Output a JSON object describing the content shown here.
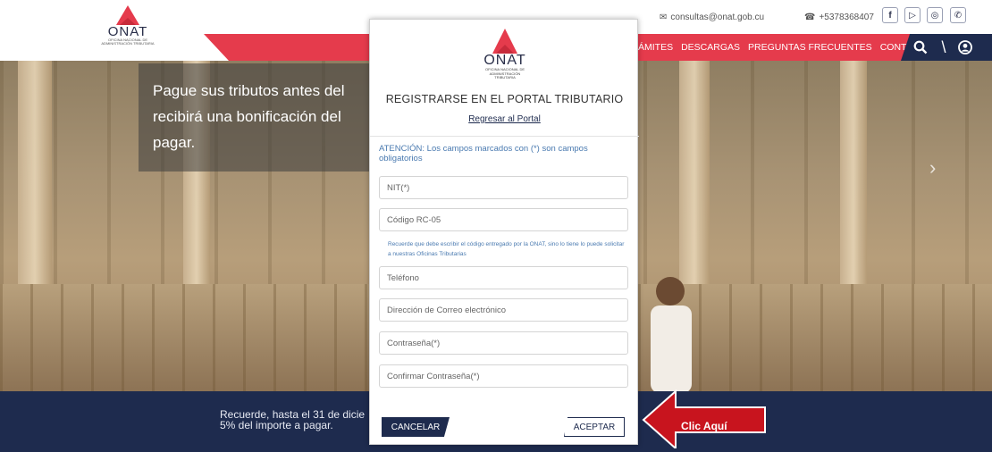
{
  "header": {
    "logo_brand": "ONAT",
    "logo_tagline_1": "OFICINA NACIONAL DE",
    "logo_tagline_2": "ADMINISTRACIÓN TRIBUTARIA",
    "email": "consultas@onat.gob.cu",
    "phone": "+5378368407",
    "nav": [
      "ÁMITES",
      "DESCARGAS",
      "PREGUNTAS FRECUENTES",
      "CONTACTO"
    ],
    "social": [
      "facebook-icon",
      "youtube-icon",
      "instagram-icon",
      "twitter-icon"
    ]
  },
  "hero": {
    "text": "Pague sus tributos antes del recibirá una bonificación del pagar."
  },
  "bottom_band": {
    "line1": "Recuerde, hasta el 31 de dicie",
    "line2": "5% del importe a pagar."
  },
  "modal": {
    "logo_brand": "ONAT",
    "logo_tagline_1": "OFICINA NACIONAL DE",
    "logo_tagline_2": "ADMINISTRACIÓN TRIBUTARIA",
    "title": "REGISTRARSE EN EL PORTAL TRIBUTARIO",
    "return_link": "Regresar al Portal",
    "warning": "ATENCIÓN: Los campos marcados con (*) son campos obligatorios",
    "fields": {
      "nit": "NIT(*)",
      "codigo": "Código RC-05",
      "telefono": "Teléfono",
      "email": "Dirección de Correo electrónico",
      "password": "Contraseña(*)",
      "confirm_password": "Confirmar Contraseña(*)"
    },
    "hint": "Recuerde que debe escribir el código entregado por la ONAT, sino lo tiene lo puede solicitar a nuestras Oficinas Tributarias",
    "cancel_label": "CANCELAR",
    "accept_label": "ACEPTAR"
  },
  "callout": {
    "label": "Clic Aquí"
  },
  "colors": {
    "brand_red": "#e53b4c",
    "brand_navy": "#1e2b4e",
    "callout_red": "#c8141e"
  }
}
